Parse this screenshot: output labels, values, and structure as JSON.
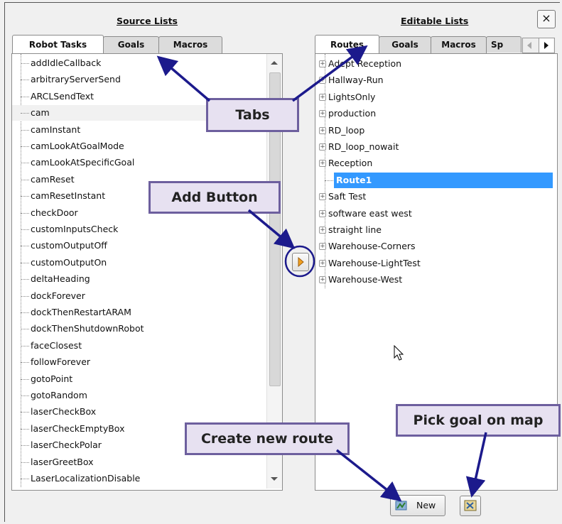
{
  "source": {
    "heading": "Source Lists",
    "tabs": [
      {
        "label": "Robot Tasks",
        "active": true
      },
      {
        "label": "Goals",
        "active": false
      },
      {
        "label": "Macros",
        "active": false
      }
    ],
    "items": [
      "addIdleCallback",
      "arbitraryServerSend",
      "ARCLSendText",
      "cam",
      "camInstant",
      "camLookAtGoalMode",
      "camLookAtSpecificGoal",
      "camReset",
      "camResetInstant",
      "checkDoor",
      "customInputsCheck",
      "customOutputOff",
      "customOutputOn",
      "deltaHeading",
      "dockForever",
      "dockThenRestartARAM",
      "dockThenShutdownRobot",
      "faceClosest",
      "followForever",
      "gotoPoint",
      "gotoRandom",
      "laserCheckBox",
      "laserCheckEmptyBox",
      "laserCheckPolar",
      "laserGreetBox",
      "LaserLocalizationDisable"
    ],
    "highlighted_item": "cam"
  },
  "editable": {
    "heading": "Editable Lists",
    "tabs": [
      {
        "label": "Routes",
        "active": true
      },
      {
        "label": "Goals",
        "active": false
      },
      {
        "label": "Macros",
        "active": false
      },
      {
        "label": "Sp",
        "active": false
      }
    ],
    "items": [
      "Adept Reception",
      "Hallway-Run",
      "LightsOnly",
      "production",
      "RD_loop",
      "RD_loop_nowait",
      "Reception",
      "Route1",
      "Saft Test",
      "software east west",
      "straight line",
      "Warehouse-Corners",
      "Warehouse-LightTest",
      "Warehouse-West"
    ],
    "selected_item": "Route1",
    "new_button_label": "New"
  },
  "close_label": "×",
  "callouts": {
    "tabs": "Tabs",
    "add_button": "Add Button",
    "create_route": "Create new route",
    "pick_goal": "Pick goal on map"
  },
  "colors": {
    "callout_fill": "#e7e1f1",
    "callout_border": "#6d5f9e",
    "arrow": "#1c1a8c",
    "selection": "#3399ff"
  }
}
